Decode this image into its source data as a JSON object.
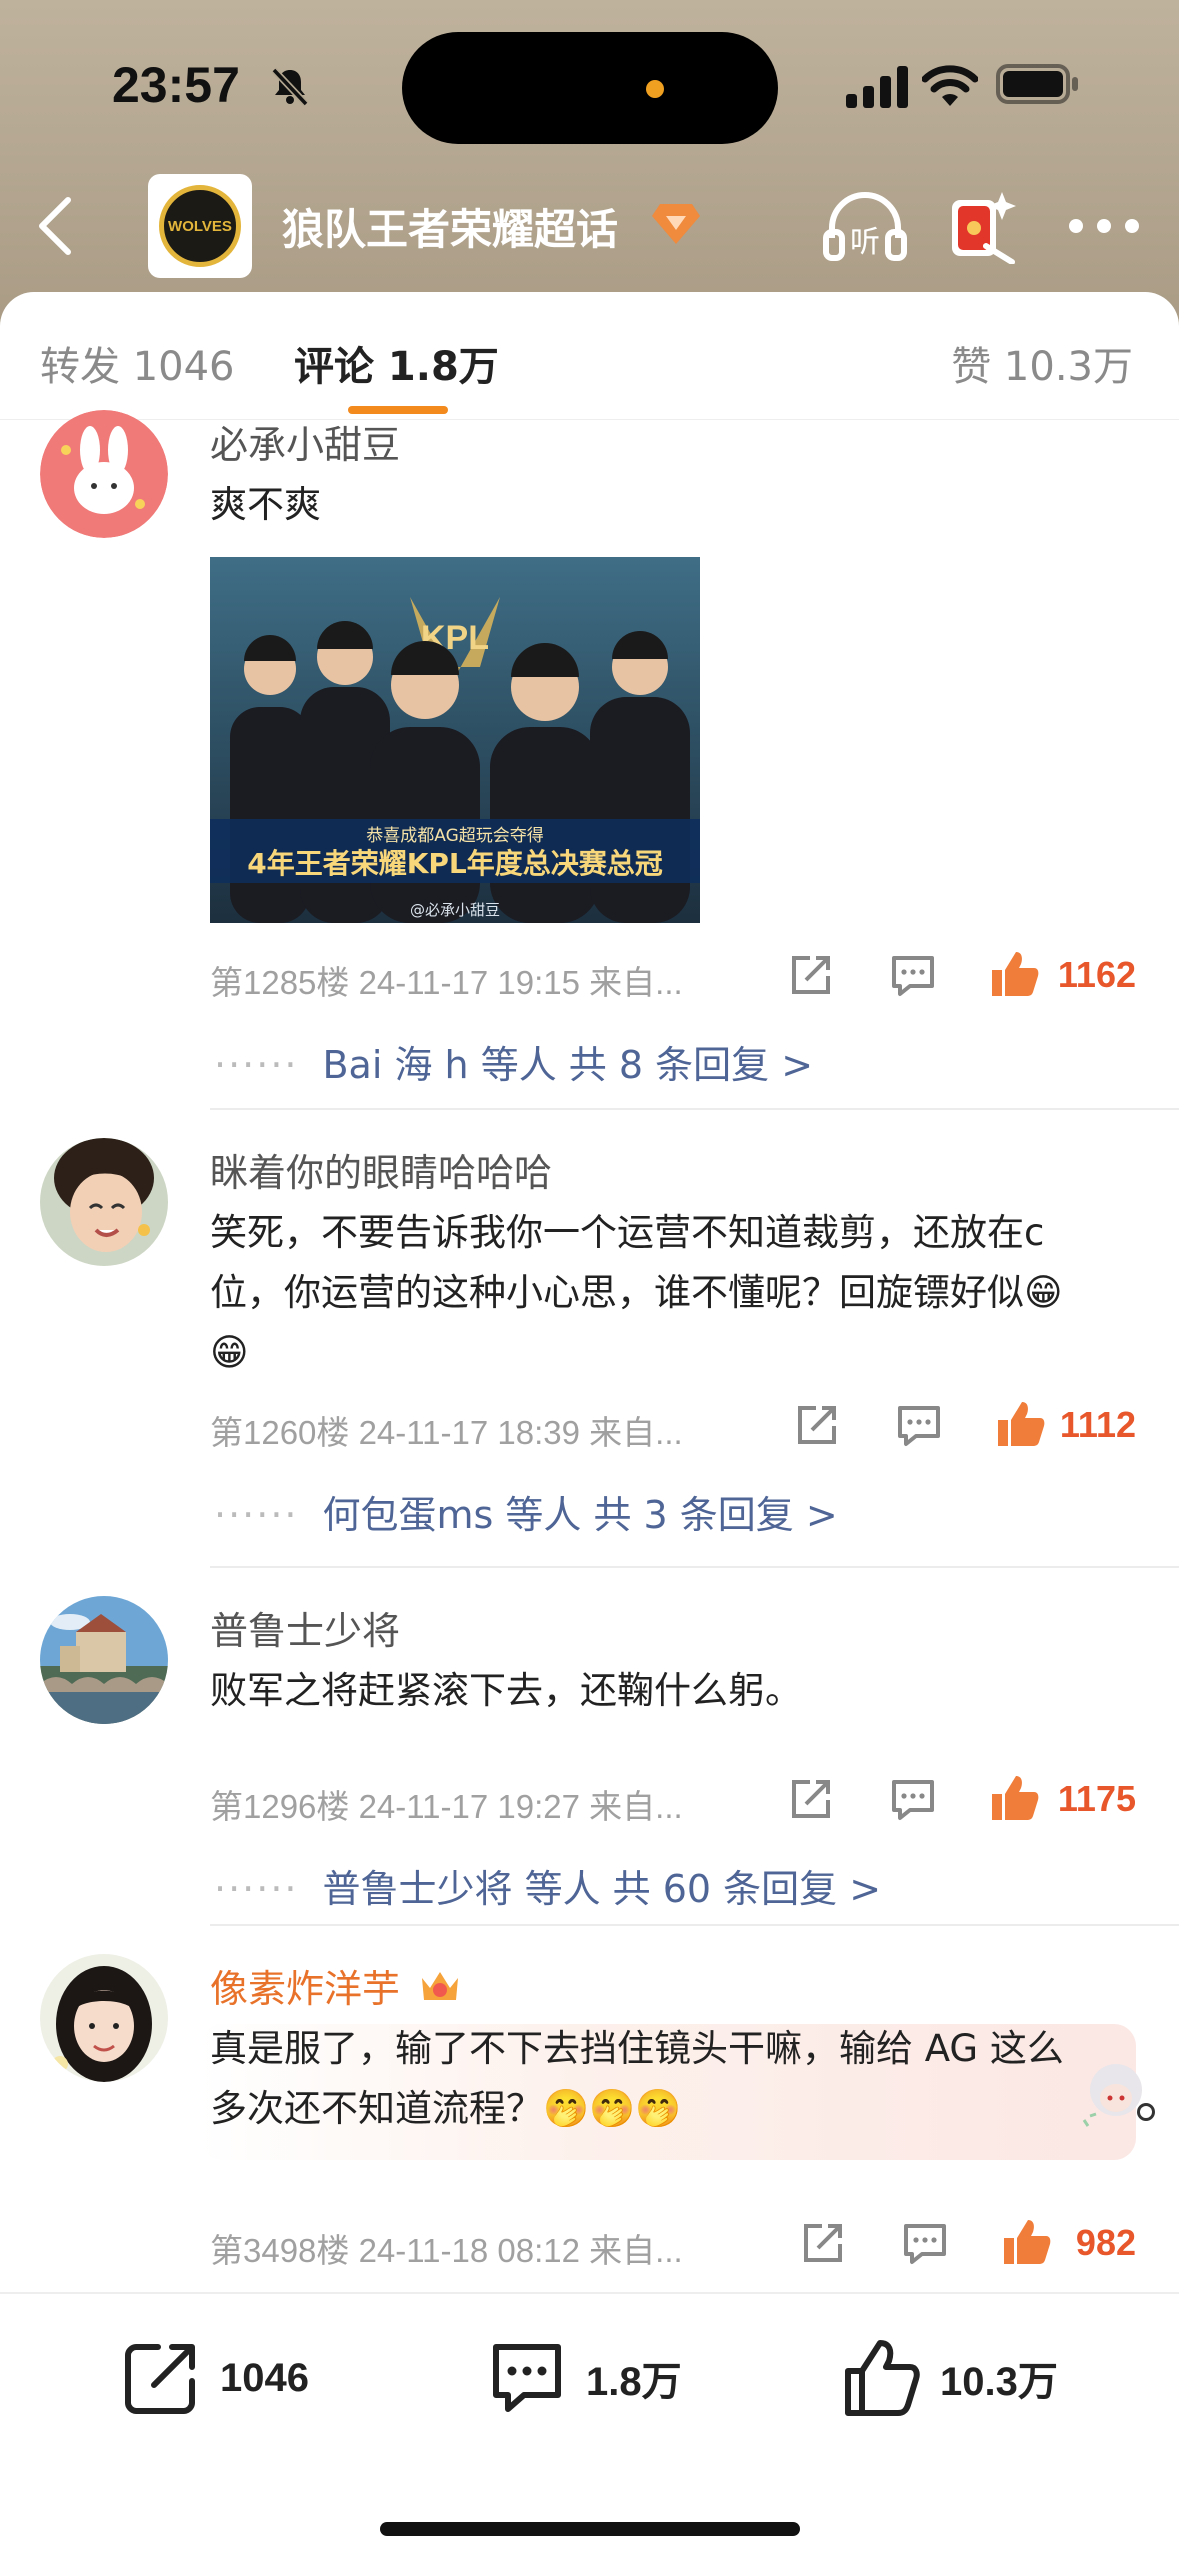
{
  "status_bar": {
    "time": "23:57"
  },
  "header": {
    "title": "狼队王者荣耀超话",
    "logo_text": "WOLVES",
    "listen_label": "听"
  },
  "tabs": {
    "repost": "转发 1046",
    "comments": "评论 1.8万",
    "likes": "赞 10.3万"
  },
  "comments": [
    {
      "user": "必承小甜豆",
      "text": "爽不爽",
      "image_caption": "恭喜成都AG超玩会夺得",
      "image_title": "4年王者荣耀KPL年度总决赛总冠",
      "image_watermark": "@必承小甜豆",
      "floor": "第1285楼 24-11-17 19:15 来自...",
      "likes": "1162",
      "replies": "Bai 海 h 等人  共 8 条回复 >"
    },
    {
      "user": "眯着你的眼睛哈哈哈",
      "text_line1": "笑死，不要告诉我你一个运营不知道裁剪，还放在c",
      "text_line2": "位，你运营的这种小心思，谁不懂呢？回旋镖好似😁",
      "text_line3": "😁",
      "floor": "第1260楼 24-11-17 18:39 来自...",
      "likes": "1112",
      "replies": "何包蛋ms 等人  共 3 条回复 >"
    },
    {
      "user": "普鲁士少将",
      "text": "败军之将赶紧滚下去，还鞠什么躬。",
      "floor": "第1296楼 24-11-17 19:27 来自...",
      "likes": "1175",
      "replies": "普鲁士少将 等人  共 60 条回复 >"
    },
    {
      "user": "像素炸洋芋",
      "text_line1": "真是服了，输了不下去挡住镜头干嘛，输给 AG 这么",
      "text_line2": "多次还不知道流程？🤭🤭🤭",
      "floor": "第3498楼 24-11-18 08:12 来自...",
      "likes": "982"
    }
  ],
  "bottom_bar": {
    "repost": "1046",
    "comment": "1.8万",
    "like": "10.3万"
  },
  "colors": {
    "accent": "#f28a1d",
    "like": "#e7572b",
    "reply_link": "#4e6596",
    "header_bg": "#b3a690"
  }
}
